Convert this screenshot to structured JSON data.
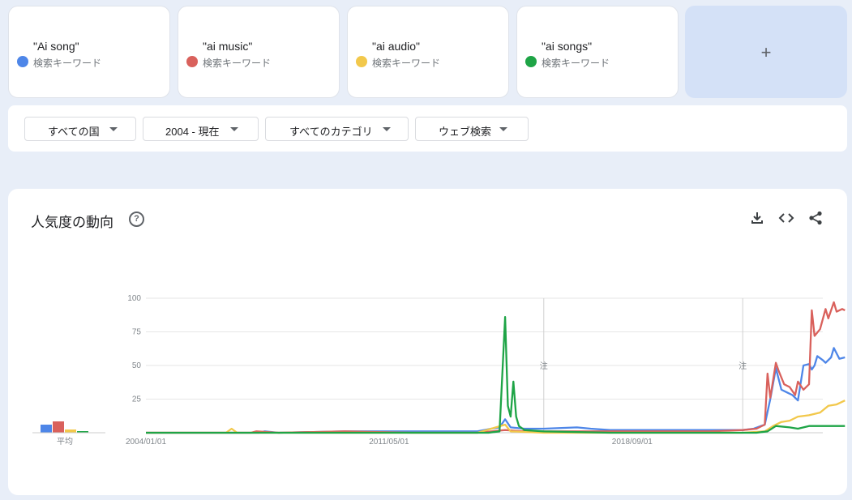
{
  "terms": [
    {
      "name": "\"Ai song\"",
      "sub": "検索キーワード",
      "color": "#4e86e8"
    },
    {
      "name": "\"ai music\"",
      "sub": "検索キーワード",
      "color": "#d9615c"
    },
    {
      "name": "\"ai audio\"",
      "sub": "検索キーワード",
      "color": "#f2c84b"
    },
    {
      "name": "\"ai songs\"",
      "sub": "検索キーワード",
      "color": "#1ea446"
    }
  ],
  "add_button": {
    "label": "+"
  },
  "filters": {
    "country": "すべての国",
    "period": "2004 - 現在",
    "category": "すべてのカテゴリ",
    "search_type": "ウェブ検索"
  },
  "chart_card": {
    "title": "人気度の動向",
    "help_icon": "help-icon"
  },
  "toolbar": [
    "download-icon",
    "embed-icon",
    "share-icon"
  ],
  "chart_data": {
    "type": "line",
    "title": "人気度の動向",
    "x_tick_labels": [
      "2004/01/01",
      "2011/05/01",
      "2018/09/01"
    ],
    "x_range": [
      "2004-01",
      "2024-06"
    ],
    "y_ticks": [
      100,
      75,
      50,
      25
    ],
    "ylim": [
      0,
      100
    ],
    "grid": true,
    "annotations": [
      {
        "x": "2016-01",
        "text": "注"
      },
      {
        "x": "2022-01",
        "text": "注"
      }
    ],
    "average_label": "平均",
    "averages": [
      5,
      7,
      2,
      1
    ],
    "series": [
      {
        "name": "\"Ai song\"",
        "color": "#4e86e8",
        "points": [
          [
            "2004-01",
            0
          ],
          [
            "2007-06",
            0
          ],
          [
            "2007-08",
            1
          ],
          [
            "2008-01",
            0
          ],
          [
            "2010-01",
            1
          ],
          [
            "2012-01",
            1
          ],
          [
            "2014-01",
            1
          ],
          [
            "2014-06",
            3
          ],
          [
            "2014-09",
            4
          ],
          [
            "2014-11",
            10
          ],
          [
            "2015-01",
            4
          ],
          [
            "2015-06",
            3
          ],
          [
            "2016-01",
            3
          ],
          [
            "2017-01",
            4
          ],
          [
            "2017-06",
            3
          ],
          [
            "2018-01",
            2
          ],
          [
            "2019-01",
            2
          ],
          [
            "2020-01",
            2
          ],
          [
            "2021-01",
            2
          ],
          [
            "2021-10",
            2
          ],
          [
            "2022-01",
            2
          ],
          [
            "2022-05",
            3
          ],
          [
            "2022-09",
            6
          ],
          [
            "2022-11",
            25
          ],
          [
            "2023-01",
            48
          ],
          [
            "2023-02",
            40
          ],
          [
            "2023-03",
            32
          ],
          [
            "2023-05",
            30
          ],
          [
            "2023-07",
            28
          ],
          [
            "2023-09",
            24
          ],
          [
            "2023-11",
            50
          ],
          [
            "2024-01",
            51
          ],
          [
            "2024-02",
            47
          ],
          [
            "2024-03",
            50
          ],
          [
            "2024-04",
            57
          ],
          [
            "2024-06",
            54
          ],
          [
            "2024-07",
            52
          ],
          [
            "2024-09",
            56
          ],
          [
            "2024-10",
            63
          ],
          [
            "2024-12",
            55
          ],
          [
            "2025-02",
            56
          ]
        ]
      },
      {
        "name": "\"ai music\"",
        "color": "#d9615c",
        "points": [
          [
            "2004-01",
            0
          ],
          [
            "2007-03",
            0
          ],
          [
            "2007-05",
            1
          ],
          [
            "2008-01",
            0
          ],
          [
            "2010-01",
            1
          ],
          [
            "2012-01",
            0
          ],
          [
            "2014-01",
            0
          ],
          [
            "2014-11",
            2
          ],
          [
            "2015-06",
            1
          ],
          [
            "2017-01",
            1
          ],
          [
            "2019-01",
            1
          ],
          [
            "2021-01",
            1
          ],
          [
            "2022-01",
            2
          ],
          [
            "2022-06",
            3
          ],
          [
            "2022-09",
            6
          ],
          [
            "2022-10",
            44
          ],
          [
            "2022-11",
            26
          ],
          [
            "2023-01",
            52
          ],
          [
            "2023-02",
            46
          ],
          [
            "2023-04",
            36
          ],
          [
            "2023-06",
            34
          ],
          [
            "2023-08",
            28
          ],
          [
            "2023-09",
            38
          ],
          [
            "2023-11",
            32
          ],
          [
            "2024-01",
            36
          ],
          [
            "2024-02",
            91
          ],
          [
            "2024-03",
            72
          ],
          [
            "2024-05",
            77
          ],
          [
            "2024-07",
            92
          ],
          [
            "2024-08",
            85
          ],
          [
            "2024-10",
            97
          ],
          [
            "2024-11",
            90
          ],
          [
            "2025-01",
            92
          ],
          [
            "2025-02",
            91
          ]
        ]
      },
      {
        "name": "\"ai audio\"",
        "color": "#f2c84b",
        "points": [
          [
            "2004-01",
            0
          ],
          [
            "2006-06",
            0
          ],
          [
            "2006-08",
            3
          ],
          [
            "2006-10",
            0
          ],
          [
            "2014-01",
            0
          ],
          [
            "2014-11",
            6
          ],
          [
            "2015-01",
            1
          ],
          [
            "2016-01",
            0
          ],
          [
            "2020-01",
            0
          ],
          [
            "2022-01",
            0
          ],
          [
            "2022-09",
            1
          ],
          [
            "2022-12",
            5
          ],
          [
            "2023-03",
            8
          ],
          [
            "2023-06",
            9
          ],
          [
            "2023-09",
            12
          ],
          [
            "2024-01",
            13
          ],
          [
            "2024-05",
            15
          ],
          [
            "2024-08",
            20
          ],
          [
            "2024-11",
            21
          ],
          [
            "2025-02",
            24
          ]
        ]
      },
      {
        "name": "\"ai songs\"",
        "color": "#1ea446",
        "points": [
          [
            "2004-01",
            0
          ],
          [
            "2014-05",
            0
          ],
          [
            "2014-09",
            1
          ],
          [
            "2014-11",
            86
          ],
          [
            "2014-12",
            20
          ],
          [
            "2015-01",
            12
          ],
          [
            "2015-02",
            38
          ],
          [
            "2015-03",
            12
          ],
          [
            "2015-04",
            5
          ],
          [
            "2015-06",
            2
          ],
          [
            "2016-01",
            1
          ],
          [
            "2018-01",
            0
          ],
          [
            "2020-01",
            0
          ],
          [
            "2022-06",
            0
          ],
          [
            "2022-10",
            1
          ],
          [
            "2023-01",
            5
          ],
          [
            "2023-06",
            4
          ],
          [
            "2023-09",
            3
          ],
          [
            "2024-01",
            5
          ],
          [
            "2024-06",
            5
          ],
          [
            "2025-02",
            5
          ]
        ]
      }
    ]
  }
}
